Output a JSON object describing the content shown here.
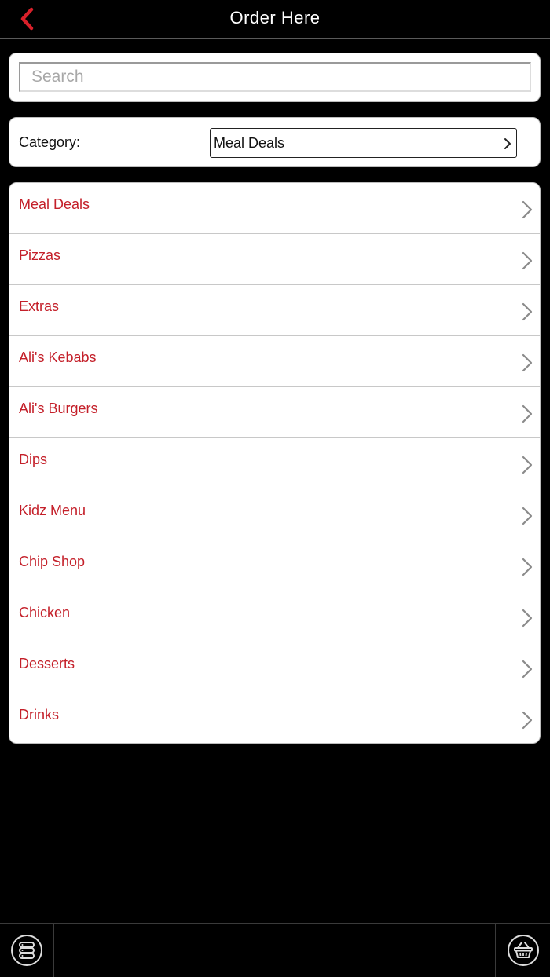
{
  "header": {
    "title": "Order Here",
    "back_icon": "chevron-left-icon",
    "accent_color": "#d8202a"
  },
  "search": {
    "placeholder": "Search",
    "value": ""
  },
  "category": {
    "label": "Category:",
    "selected": "Meal Deals"
  },
  "menu": {
    "item_color": "#c4202a",
    "items": [
      {
        "label": "Meal Deals"
      },
      {
        "label": "Pizzas"
      },
      {
        "label": "Extras"
      },
      {
        "label": "Ali's Kebabs"
      },
      {
        "label": "Ali's Burgers"
      },
      {
        "label": "Dips"
      },
      {
        "label": "Kidz Menu"
      },
      {
        "label": "Chip Shop"
      },
      {
        "label": "Chicken"
      },
      {
        "label": "Desserts"
      },
      {
        "label": "Drinks"
      }
    ]
  },
  "bottom_bar": {
    "left_icon": "menu-list-icon",
    "right_icon": "basket-icon"
  }
}
